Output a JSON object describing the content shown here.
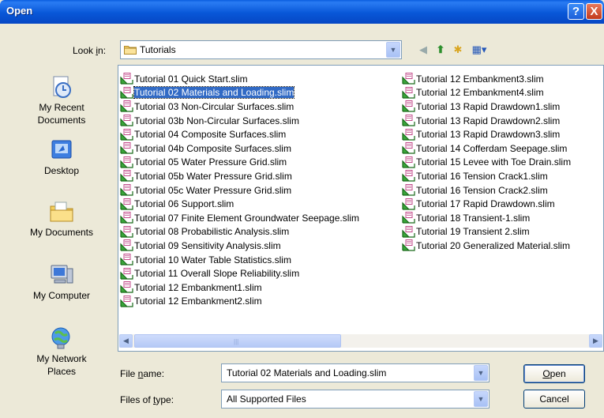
{
  "window": {
    "title": "Open",
    "help_label": "?",
    "close_label": "X"
  },
  "toolbar": {
    "lookin_label_pre": "Look ",
    "lookin_label_u": "i",
    "lookin_label_post": "n:",
    "lookin_value": "Tutorials"
  },
  "places": [
    {
      "label_line1": "My Recent",
      "label_line2": "Documents",
      "icon": "recent-documents-icon"
    },
    {
      "label_line1": "Desktop",
      "label_line2": "",
      "icon": "desktop-icon"
    },
    {
      "label_line1": "My Documents",
      "label_line2": "",
      "icon": "my-documents-icon"
    },
    {
      "label_line1": "My Computer",
      "label_line2": "",
      "icon": "my-computer-icon"
    },
    {
      "label_line1": "My Network",
      "label_line2": "Places",
      "icon": "network-places-icon"
    }
  ],
  "files_col1": [
    "Tutorial 01 Quick Start.slim",
    "Tutorial 02 Materials and Loading.slim",
    "Tutorial 03 Non-Circular Surfaces.slim",
    "Tutorial 03b Non-Circular Surfaces.slim",
    "Tutorial 04 Composite Surfaces.slim",
    "Tutorial 04b Composite Surfaces.slim",
    "Tutorial 05 Water Pressure Grid.slim",
    "Tutorial 05b Water Pressure Grid.slim",
    "Tutorial 05c Water Pressure Grid.slim",
    "Tutorial 06 Support.slim",
    "Tutorial 07 Finite Element Groundwater Seepage.slim",
    "Tutorial 08 Probabilistic Analysis.slim",
    "Tutorial 09 Sensitivity Analysis.slim",
    "Tutorial 10 Water Table Statistics.slim",
    "Tutorial 11 Overall Slope Reliability.slim",
    "Tutorial 12 Embankment1.slim",
    "Tutorial 12 Embankment2.slim"
  ],
  "files_col2": [
    "Tutorial 12 Embankment3.slim",
    "Tutorial 12 Embankment4.slim",
    "Tutorial 13 Rapid Drawdown1.slim",
    "Tutorial 13 Rapid Drawdown2.slim",
    "Tutorial 13 Rapid Drawdown3.slim",
    "Tutorial 14 Cofferdam Seepage.slim",
    "Tutorial 15 Levee with Toe Drain.slim",
    "Tutorial 16 Tension Crack1.slim",
    "Tutorial 16 Tension Crack2.slim",
    "Tutorial 17 Rapid Drawdown.slim",
    "Tutorial 18 Transient-1.slim",
    "Tutorial 19 Transient 2.slim",
    "Tutorial 20 Generalized Material.slim"
  ],
  "selected_file": "Tutorial 02 Materials and Loading.slim",
  "filename": {
    "label_pre": "File ",
    "label_u": "n",
    "label_post": "ame:",
    "value": "Tutorial 02 Materials and Loading.slim"
  },
  "filetype": {
    "label_pre": "Files of ",
    "label_u": "t",
    "label_post": "ype:",
    "value": "All Supported Files"
  },
  "buttons": {
    "open_u": "O",
    "open_rest": "pen",
    "cancel": "Cancel"
  },
  "colors": {
    "title_bar": "#0a5ddf",
    "selection": "#316ac5",
    "dialog_bg": "#ece9d8"
  }
}
